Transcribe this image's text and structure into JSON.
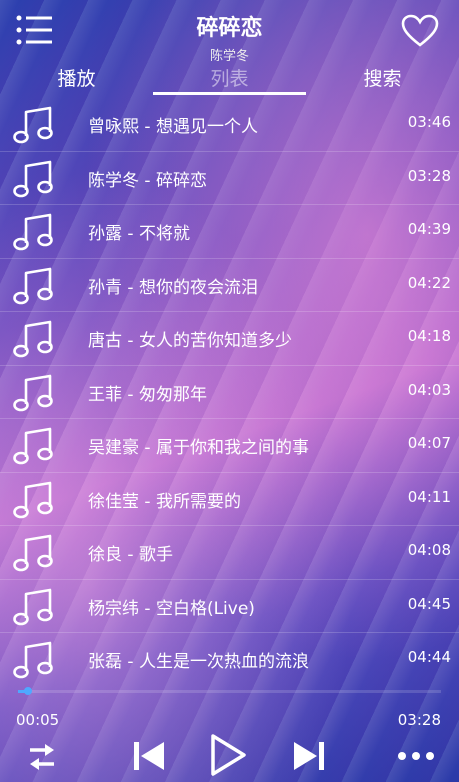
{
  "header": {
    "title": "碎碎恋",
    "artist": "陈学冬"
  },
  "tabs": [
    {
      "label": "播放"
    },
    {
      "label": "列表"
    },
    {
      "label": "搜索"
    }
  ],
  "playlist": [
    {
      "name": "曾咏熙 - 想遇见一个人",
      "duration": "03:46"
    },
    {
      "name": "陈学冬 - 碎碎恋",
      "duration": "03:28"
    },
    {
      "name": "孙露 - 不将就",
      "duration": "04:39"
    },
    {
      "name": "孙青 - 想你的夜会流泪",
      "duration": "04:22"
    },
    {
      "name": "唐古 - 女人的苦你知道多少",
      "duration": "04:18"
    },
    {
      "name": "王菲 - 匆匆那年",
      "duration": "04:03"
    },
    {
      "name": "吴建豪 - 属于你和我之间的事",
      "duration": "04:07"
    },
    {
      "name": "徐佳莹 - 我所需要的",
      "duration": "04:11"
    },
    {
      "name": "徐良 - 歌手",
      "duration": "04:08"
    },
    {
      "name": "杨宗纬 - 空白格(Live)",
      "duration": "04:45"
    },
    {
      "name": "张磊 - 人生是一次热血的流浪",
      "duration": "04:44"
    }
  ],
  "player": {
    "current_time": "00:05",
    "total_time": "03:28",
    "progress_fraction": 0.024
  },
  "icons": {
    "menu": "menu-icon",
    "favorite": "heart-icon",
    "song": "music-note-icon",
    "shuffle": "shuffle-icon",
    "previous": "previous-icon",
    "play": "play-icon",
    "next": "next-icon",
    "more": "more-icon"
  },
  "colors": {
    "progress": "#4fa8ff"
  }
}
